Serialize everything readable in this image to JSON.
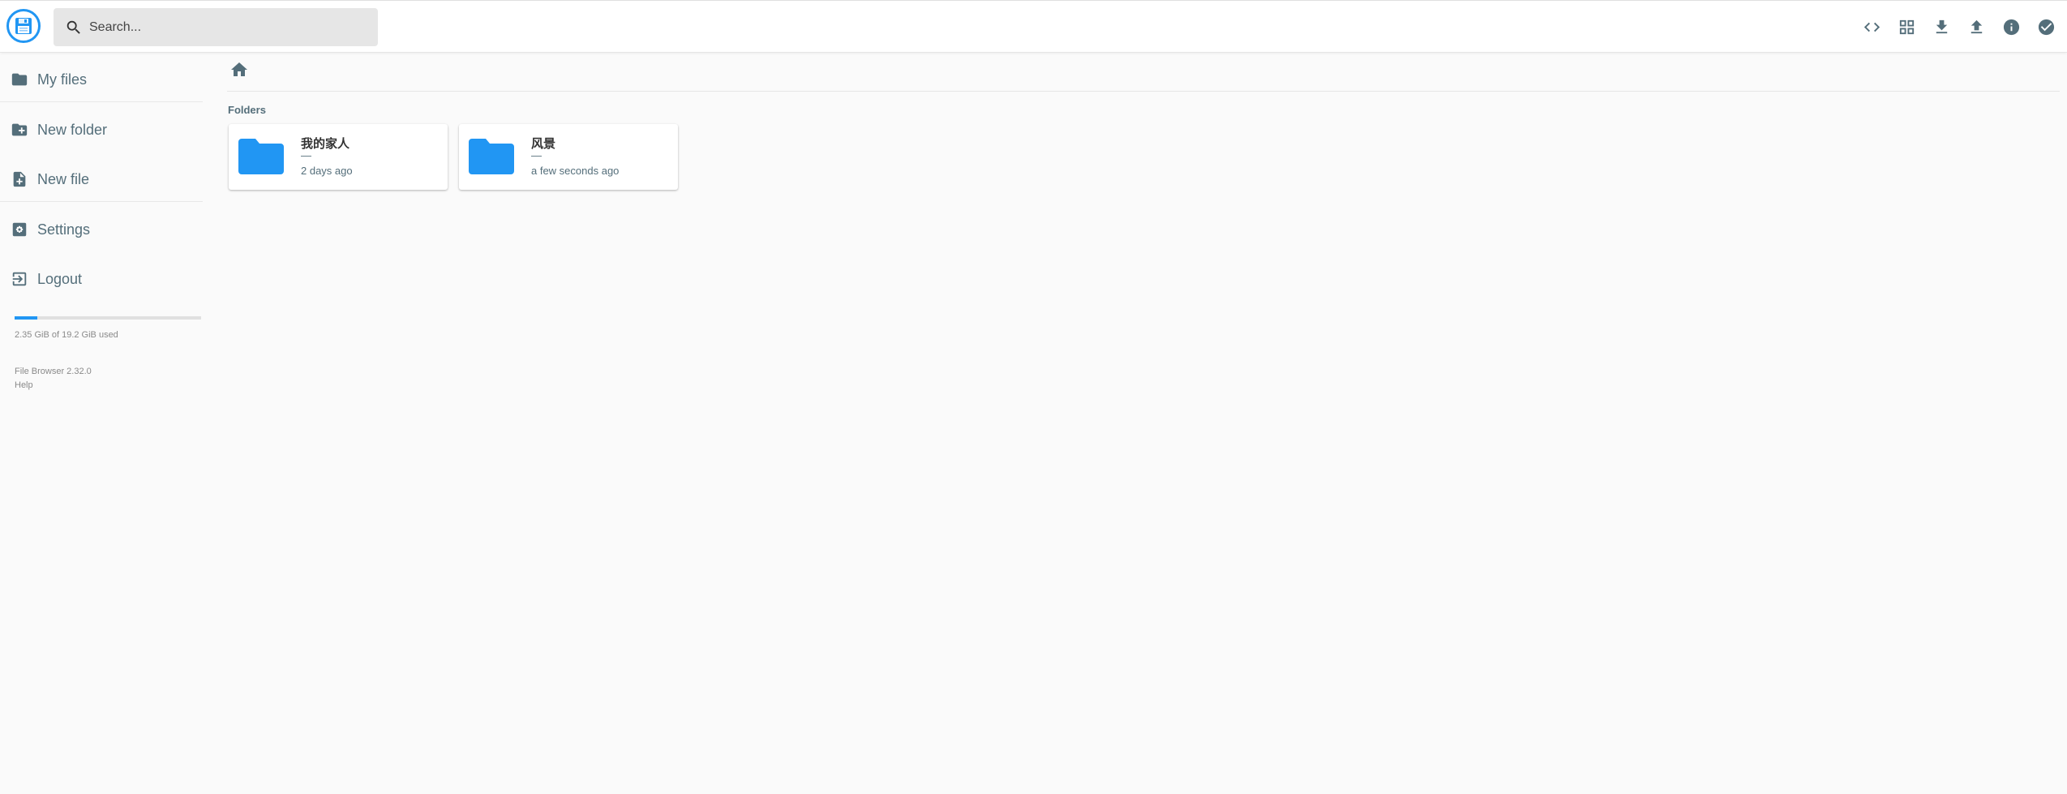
{
  "header": {
    "search": {
      "placeholder": "Search...",
      "value": ""
    },
    "actions": [
      {
        "name": "toggle-code-icon"
      },
      {
        "name": "grid-view-icon"
      },
      {
        "name": "download-icon"
      },
      {
        "name": "upload-icon"
      },
      {
        "name": "info-icon"
      },
      {
        "name": "select-check-icon"
      }
    ]
  },
  "sidebar": {
    "items": [
      {
        "label": "My files",
        "icon": "folder-icon"
      },
      {
        "label": "New folder",
        "icon": "create-folder-icon"
      },
      {
        "label": "New file",
        "icon": "note-add-icon"
      },
      {
        "label": "Settings",
        "icon": "settings-icon"
      },
      {
        "label": "Logout",
        "icon": "logout-icon"
      }
    ],
    "quota": {
      "text": "2.35 GiB of 19.2 GiB used",
      "used_fraction": 0.122
    },
    "credits": {
      "version": "File Browser 2.32.0",
      "help": "Help"
    }
  },
  "main": {
    "section_title": "Folders",
    "folders": [
      {
        "name": "我的家人",
        "size": "—",
        "modified": "2 days ago"
      },
      {
        "name": "风景",
        "size": "—",
        "modified": "a few seconds ago"
      }
    ]
  },
  "colors": {
    "accent": "#2196f3",
    "text": "#546e7a",
    "background": "#fafafa",
    "search_bg": "#e6e6e6"
  }
}
